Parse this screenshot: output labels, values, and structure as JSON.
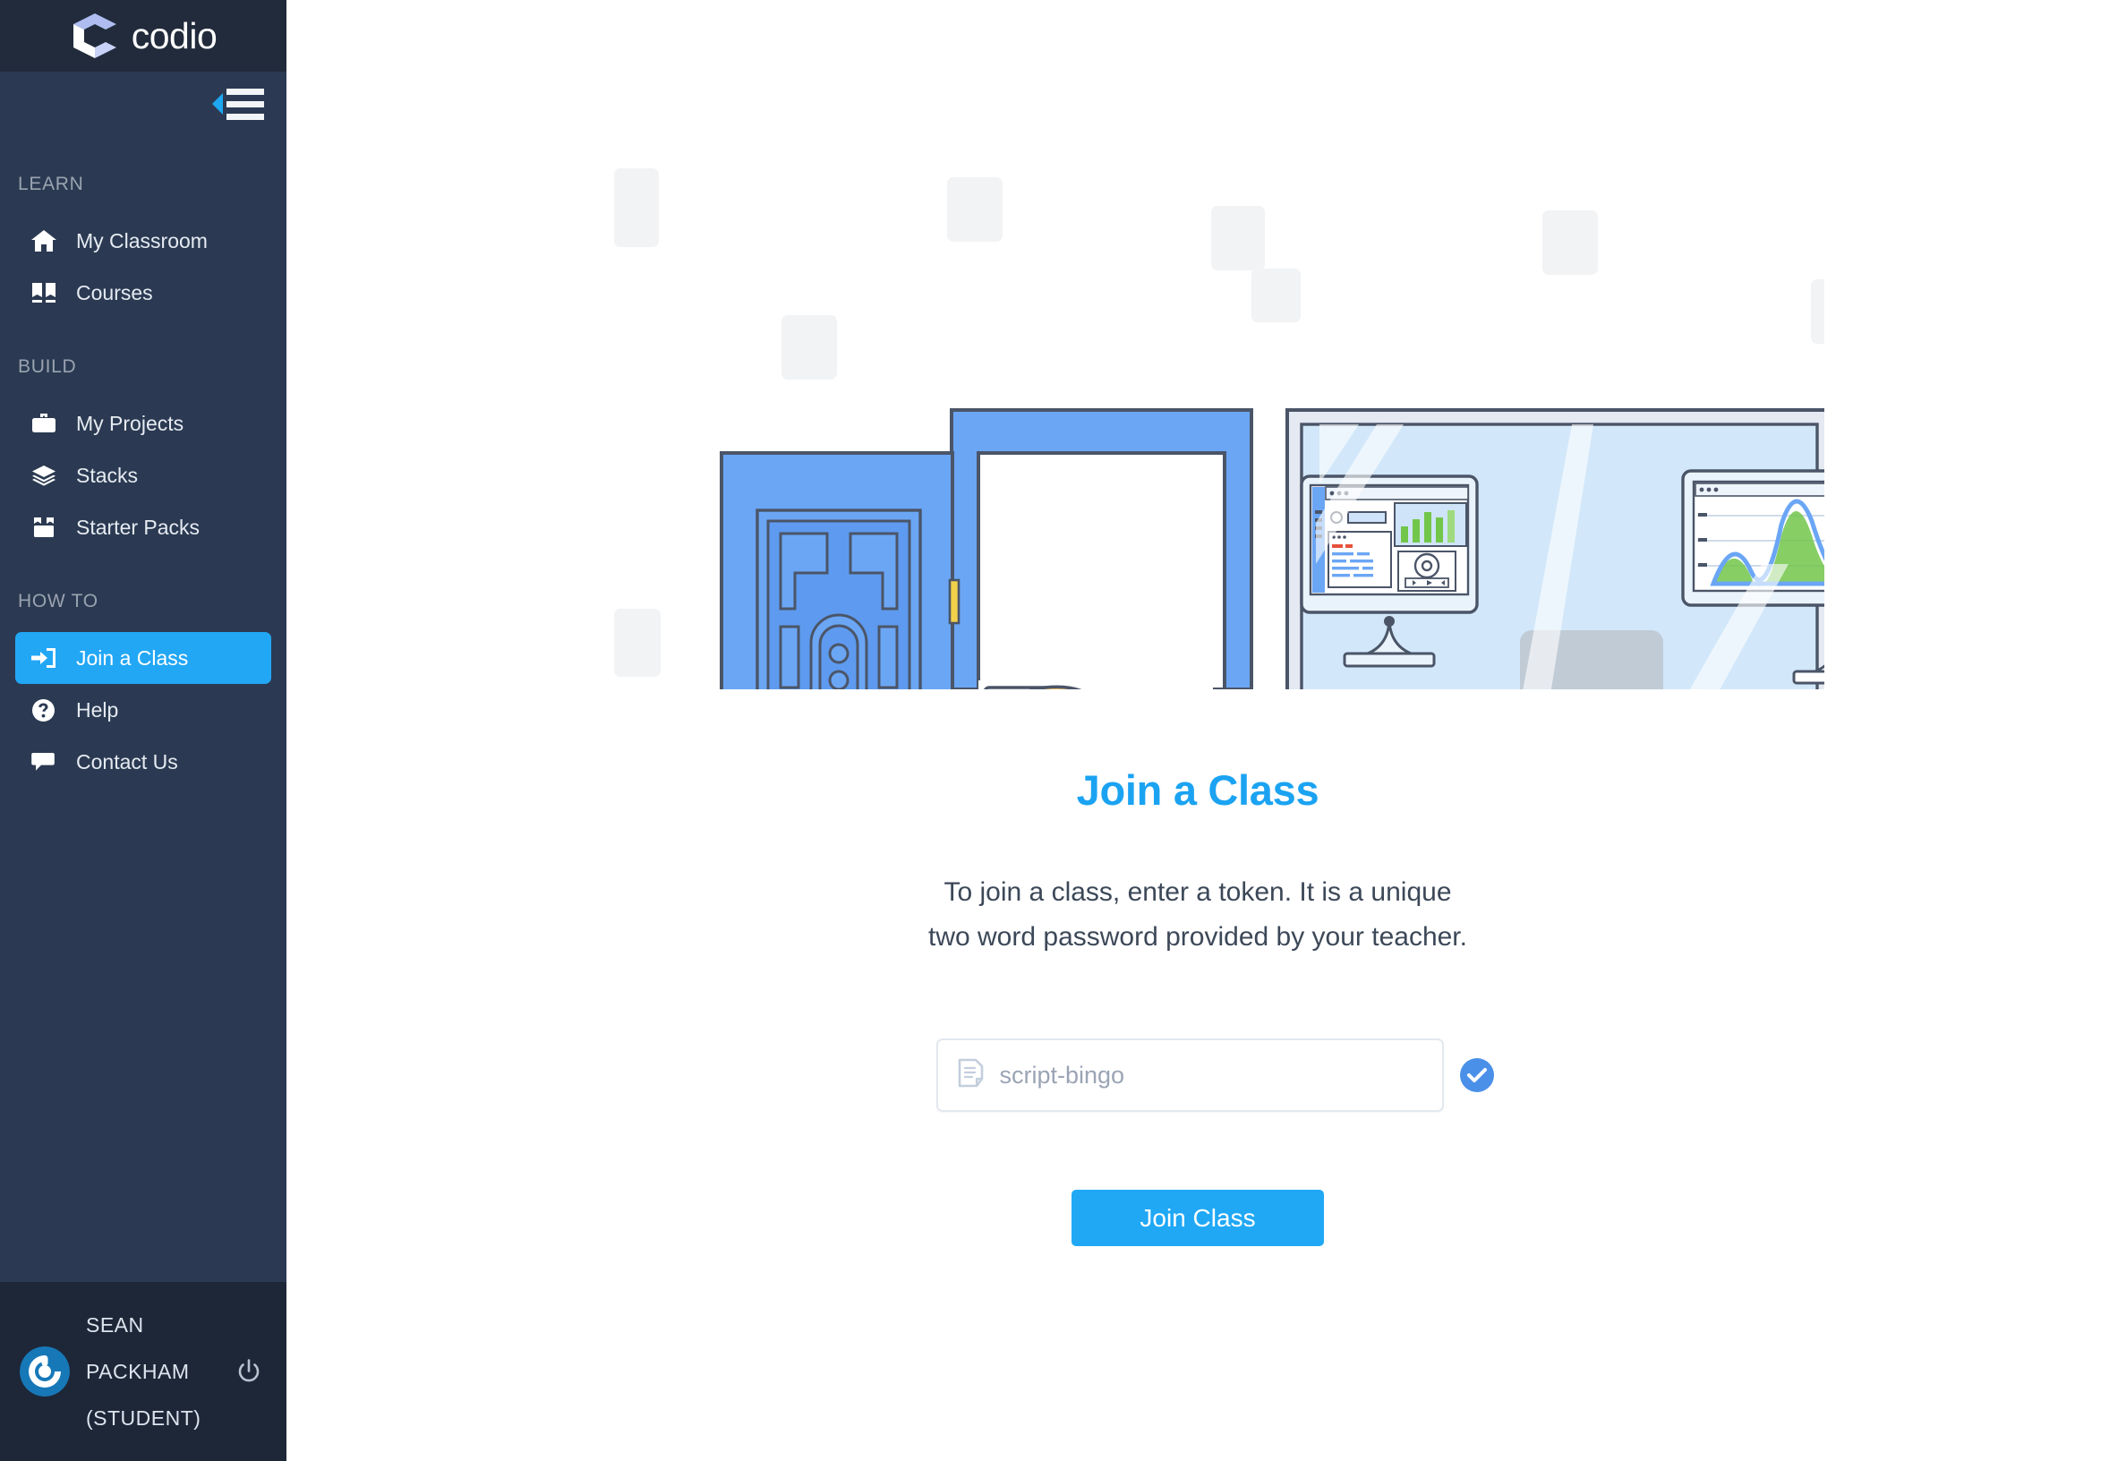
{
  "brand": {
    "name": "codio",
    "logo_icon": "codio-cube-logo",
    "accent_color": "#20a8f5",
    "sidebar_color": "#2b3a52",
    "sidebar_header_color": "#212b3b",
    "sidebar_footer_color": "#1d2738"
  },
  "sidebar": {
    "collapse_icon": "collapse-menu-icon",
    "groups": [
      {
        "label": "LEARN",
        "items": [
          {
            "label": "My Classroom",
            "icon": "home-icon",
            "active": false
          },
          {
            "label": "Courses",
            "icon": "books-icon",
            "active": false
          }
        ]
      },
      {
        "label": "BUILD",
        "items": [
          {
            "label": "My Projects",
            "icon": "briefcase-icon",
            "active": false
          },
          {
            "label": "Stacks",
            "icon": "layers-icon",
            "active": false
          },
          {
            "label": "Starter Packs",
            "icon": "box-open-icon",
            "active": false
          }
        ]
      },
      {
        "label": "HOW TO",
        "items": [
          {
            "label": "Join a Class",
            "icon": "sign-in-icon",
            "active": true
          },
          {
            "label": "Help",
            "icon": "question-circle-icon",
            "active": false
          },
          {
            "label": "Contact Us",
            "icon": "comment-icon",
            "active": false
          }
        ]
      }
    ],
    "user": {
      "name": "SEAN PACKHAM (STUDENT)",
      "avatar_icon": "gravatar-avatar",
      "logout_icon": "power-icon"
    }
  },
  "main": {
    "illustration": "open-door-student-waving-window-computers",
    "title": "Join a Class",
    "description": "To join a class, enter a token. It is a unique two word password provided by your teacher.",
    "token": {
      "icon": "document-icon",
      "placeholder": "script-bingo",
      "value": "",
      "valid_icon": "check-circle-icon"
    },
    "join_button": "Join Class"
  }
}
